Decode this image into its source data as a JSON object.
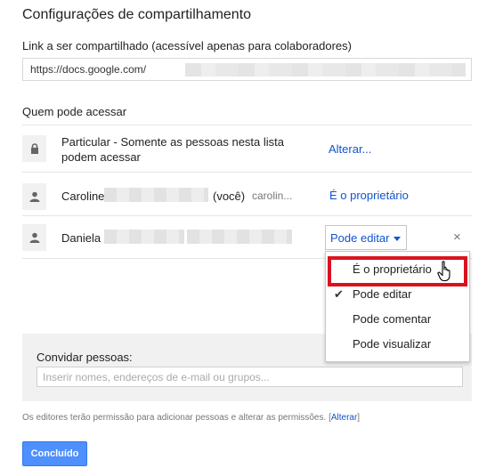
{
  "title": "Configurações de compartilhamento",
  "link_section": {
    "label": "Link a ser compartilhado (acessível apenas para colaboradores)",
    "url_prefix": "https://docs.google.com/"
  },
  "access_section": {
    "label": "Quem pode acessar",
    "rows": [
      {
        "icon": "lock-icon",
        "text": "Particular - Somente as pessoas nesta lista podem acessar",
        "action": "Alterar..."
      },
      {
        "icon": "person-icon",
        "name": "Caroline",
        "suffix": "(você)",
        "email_prefix": "carolin...",
        "role": "É o proprietário"
      },
      {
        "icon": "person-icon",
        "name": "Daniela",
        "role": "Pode editar",
        "remove": "×"
      }
    ]
  },
  "role_menu": {
    "items": [
      "É o proprietário",
      "Pode editar",
      "Pode comentar",
      "Pode visualizar"
    ],
    "checked": "Pode editar",
    "highlighted": "É o proprietário"
  },
  "invite": {
    "label": "Convidar pessoas:",
    "placeholder": "Inserir nomes, endereços de e-mail ou grupos..."
  },
  "footnote": {
    "text": "Os editores terão permissão para adicionar pessoas e alterar as permissões.",
    "open_bracket": "[",
    "link": "Alterar",
    "close_bracket": "]"
  },
  "done_button": "Concluído",
  "colors": {
    "link_blue": "#1155cc",
    "primary_button": "#4d90fe",
    "highlight_red": "#d9131e"
  }
}
